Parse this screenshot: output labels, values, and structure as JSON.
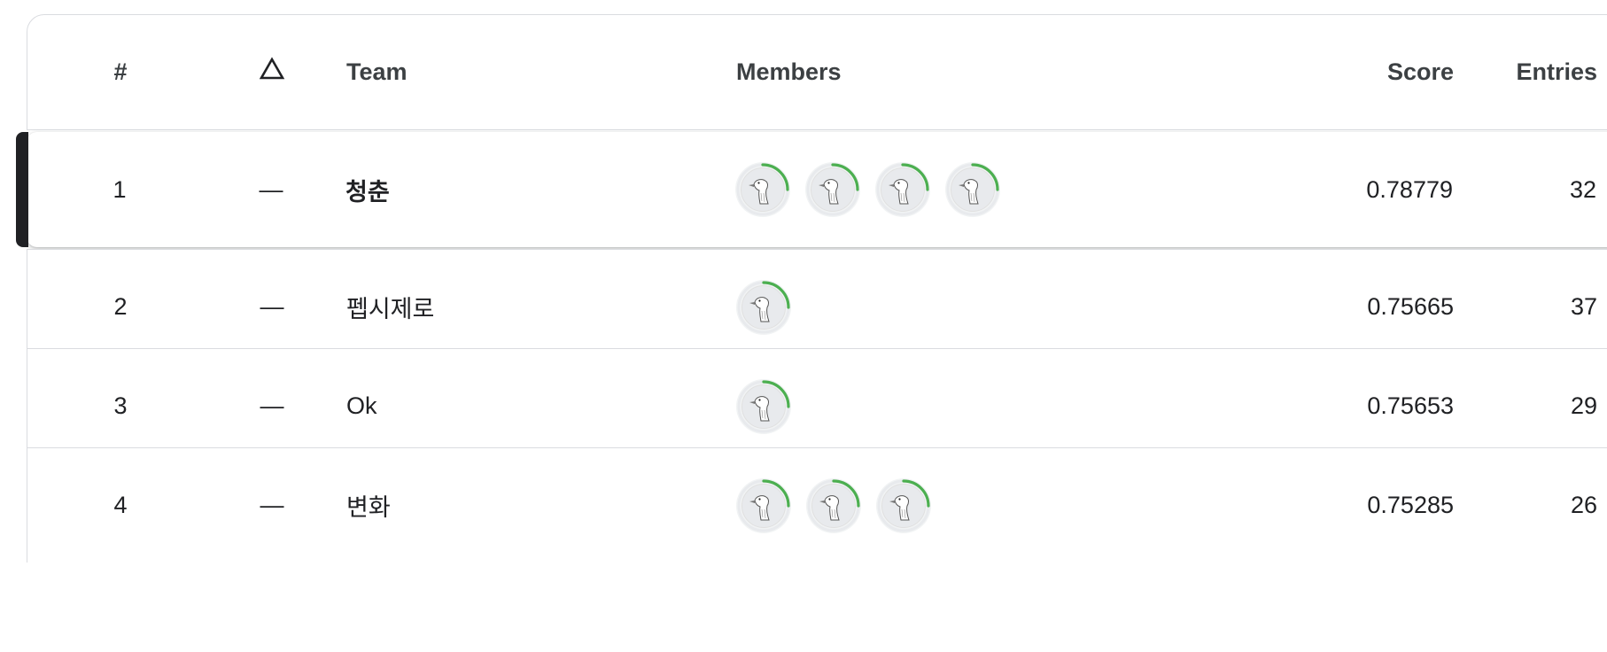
{
  "columns": {
    "rank": "#",
    "delta_icon": "triangle-outline-icon",
    "team": "Team",
    "members": "Members",
    "score": "Score",
    "entries": "Entries"
  },
  "colors": {
    "progress_ring": "#4caf50",
    "highlight_bar": "#202124",
    "divider": "#dadce0"
  },
  "rows": [
    {
      "rank": "1",
      "delta": "—",
      "team": "청춘",
      "member_count": 4,
      "score": "0.78779",
      "entries": "32",
      "highlighted": true
    },
    {
      "rank": "2",
      "delta": "—",
      "team": "펩시제로",
      "member_count": 1,
      "score": "0.75665",
      "entries": "37",
      "highlighted": false
    },
    {
      "rank": "3",
      "delta": "—",
      "team": "Ok",
      "member_count": 1,
      "score": "0.75653",
      "entries": "29",
      "highlighted": false
    },
    {
      "rank": "4",
      "delta": "—",
      "team": "변화",
      "member_count": 3,
      "score": "0.75285",
      "entries": "26",
      "highlighted": false
    }
  ]
}
